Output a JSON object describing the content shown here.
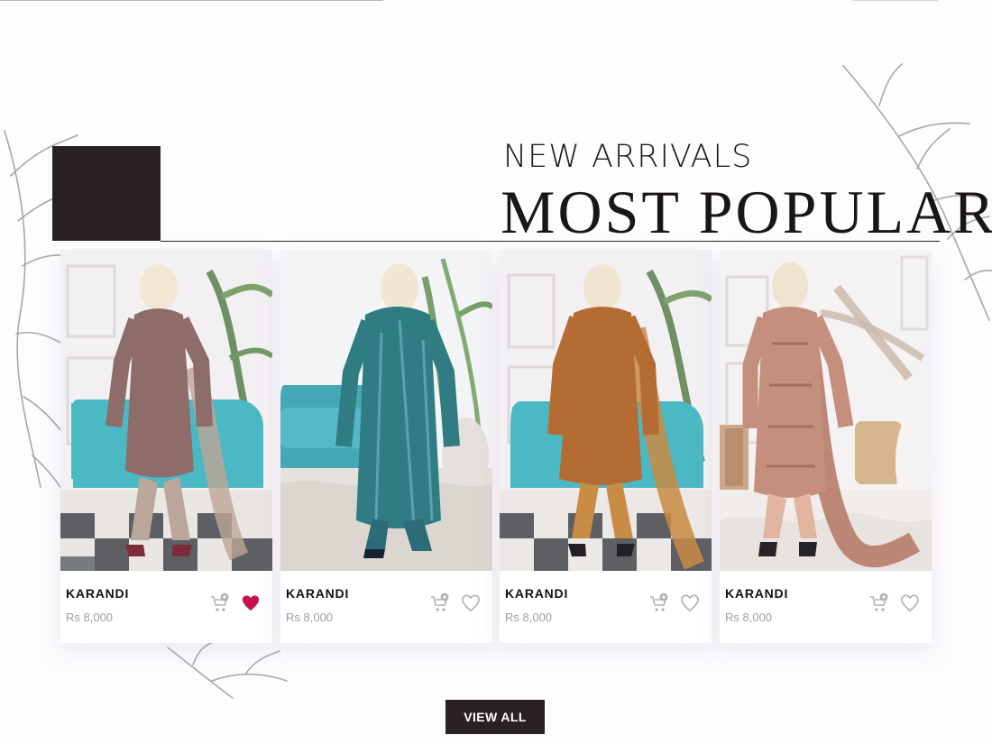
{
  "section": {
    "subtitle": "NEW ARRIVALS",
    "title": "MOST POPULAR"
  },
  "products": [
    {
      "name": "KARANDI",
      "price": "Rs 8,000",
      "wishlisted": true,
      "outfit_color": "#8e6c69",
      "scarf_color": "#bda695"
    },
    {
      "name": "KARANDI",
      "price": "Rs 8,000",
      "wishlisted": false,
      "outfit_color": "#2f7d82",
      "scarf_color": "#2f6f74"
    },
    {
      "name": "KARANDI",
      "price": "Rs 8,000",
      "wishlisted": false,
      "outfit_color": "#b56c32",
      "scarf_color": "#c98a45"
    },
    {
      "name": "KARANDI",
      "price": "Rs 8,000",
      "wishlisted": false,
      "outfit_color": "#c48f7c",
      "scarf_color": "#b77b69"
    }
  ],
  "actions": {
    "view_all": "VIEW ALL"
  },
  "colors": {
    "brand_dark": "#2a2123",
    "wishlist_active": "#c70f4b",
    "muted_icon": "#b3aeb2"
  },
  "icons": {
    "cart": "cart-plus-icon",
    "wishlist": "heart-icon"
  }
}
